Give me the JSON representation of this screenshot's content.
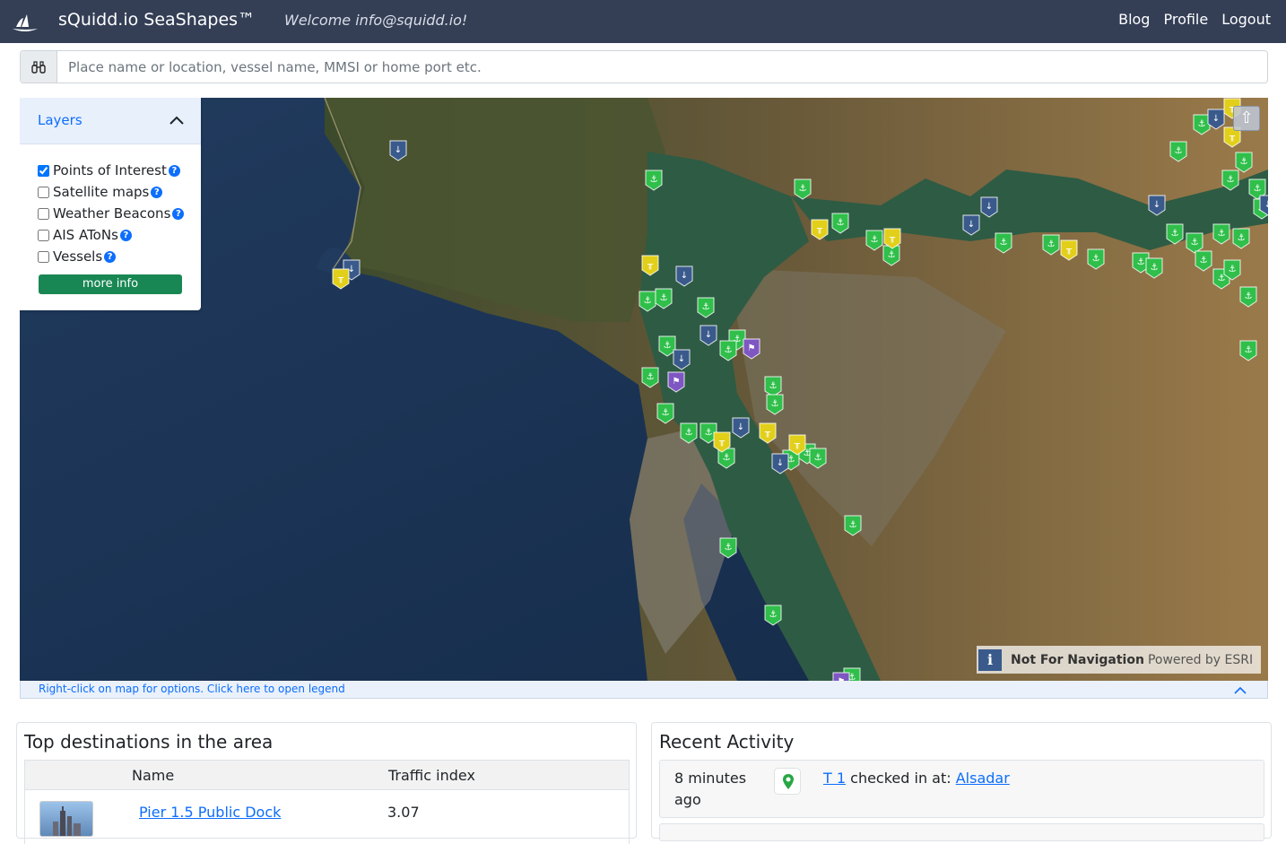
{
  "navbar": {
    "brand": "sQuidd.io SeaShapes™",
    "welcome": "Welcome info@squidd.io!",
    "links": [
      "Blog",
      "Profile",
      "Logout"
    ]
  },
  "search": {
    "placeholder": "Place name or location, vessel name, MMSI or home port etc.",
    "icon": "binoculars-icon"
  },
  "layers": {
    "title": "Layers",
    "items": [
      {
        "label": "Points of Interest",
        "checked": true
      },
      {
        "label": "Satellite maps",
        "checked": false
      },
      {
        "label": "Weather Beacons",
        "checked": false
      },
      {
        "label": "AIS AToNs",
        "checked": false
      },
      {
        "label": "Vessels",
        "checked": false
      }
    ],
    "more_info": "more info"
  },
  "map": {
    "attribution_icon": "i",
    "not_for_navigation": "Not For Navigation",
    "powered_by": "Powered by ESRI",
    "top_button": "⇧",
    "legend_hint": "Right-click on map for options. Click here to open legend",
    "marker_colors": {
      "marina": "#2fbf4a",
      "anchorage": "#3a5a8c",
      "bridge": "#e2cf1a",
      "flag": "#7e57c2"
    }
  },
  "destinations": {
    "title": "Top destinations in the area",
    "columns": [
      "Name",
      "Traffic index"
    ],
    "rows": [
      {
        "name": "Pier 1.5 Public Dock",
        "traffic": "3.07"
      }
    ]
  },
  "recent": {
    "title": "Recent Activity",
    "items": [
      {
        "time": "8 minutes ago",
        "user": "T 1",
        "action": "checked in at:",
        "place": "Alsadar"
      }
    ]
  }
}
